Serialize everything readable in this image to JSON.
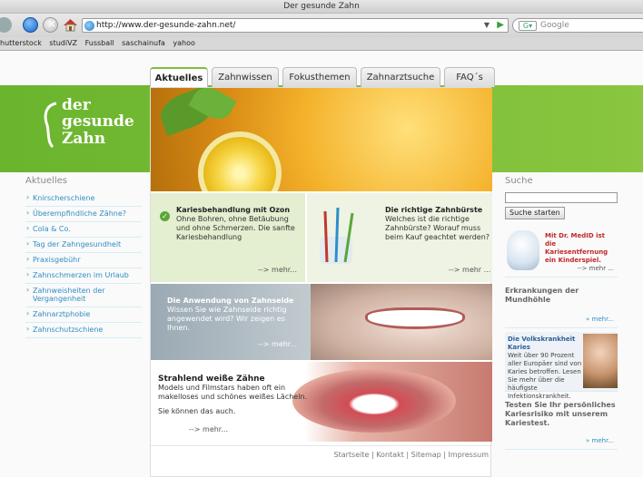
{
  "browser": {
    "window_title": "Der gesunde Zahn",
    "url": "http://www.der-gesunde-zahn.net/",
    "search_placeholder": "Google",
    "bookmarks": [
      "hutterstock",
      "studiVZ",
      "Fussball",
      "saschainufa",
      "yahoo"
    ]
  },
  "site": {
    "logo": {
      "line1": "der",
      "line2": "gesunde",
      "line3": "Zahn"
    },
    "tabs": [
      {
        "label": "Aktuelles",
        "active": true
      },
      {
        "label": "Zahnwissen",
        "active": false
      },
      {
        "label": "Fokusthemen",
        "active": false
      },
      {
        "label": "Zahnarztsuche",
        "active": false
      },
      {
        "label": "FAQ´s",
        "active": false
      }
    ],
    "colors": {
      "brand_green": "#7bbf3a",
      "link_blue": "#2f8fc5"
    }
  },
  "left_nav": {
    "heading": "Aktuelles",
    "items": [
      "Knirscherschiene",
      "Überempfindliche Zähne?",
      "Cola & Co.",
      "Tag der Zahngesundheit",
      "Praxisgebühr",
      "Zahnschmerzen im Urlaub",
      "Zahnweisheiten der Vergangenheit",
      "Zahnarztphobie",
      "Zahnschutzschiene"
    ]
  },
  "content": {
    "teaser1": {
      "title": "Kariesbehandlung mit Ozon",
      "text": "Ohne Bohren, ohne Betäubung und ohne Schmerzen. Die sanfte Kariesbehandlung",
      "more": "--> mehr..."
    },
    "teaser2": {
      "title": "Die richtige Zahnbürste",
      "text": "Welches ist die richtige Zahnbürste? Worauf muss beim Kauf geachtet werden?",
      "more": "--> mehr ..."
    },
    "teaser3": {
      "title": "Die Anwendung von Zahnseide",
      "text": "Wissen Sie wie Zahnseide richtig angewendet wird? Wir zeigen es Ihnen.",
      "more": "--> mehr..."
    },
    "teaser4": {
      "title": "Strahlend weiße Zähne",
      "text": "Models und Filmstars haben oft ein makelloses und schönes weißes Lächeln.",
      "text2": "Sie können das auch.",
      "more": "--> mehr..."
    },
    "footer_links": "Startseite | Kontakt | Sitemap | Impressum"
  },
  "right_col": {
    "search_heading": "Suche",
    "search_button": "Suche starten",
    "box1": {
      "text": "Mit Dr. MedID ist die Kariesentfernung ein Kinderspiel.",
      "more": "--> mehr ..."
    },
    "box2": {
      "title": "Erkrankungen der Mundhöhle",
      "more": "» mehr..."
    },
    "box3": {
      "title": "Die Volkskrankheit Karies",
      "text": "Weit über 90 Prozent aller Europäer sind von Karies betroffen. Lesen Sie mehr über die häufigste Infektionskrankheit."
    },
    "box4": {
      "title": "Testen Sie Ihr persönliches Kariesrisiko mit unserem Kariestest.",
      "more": "» mehr..."
    }
  }
}
